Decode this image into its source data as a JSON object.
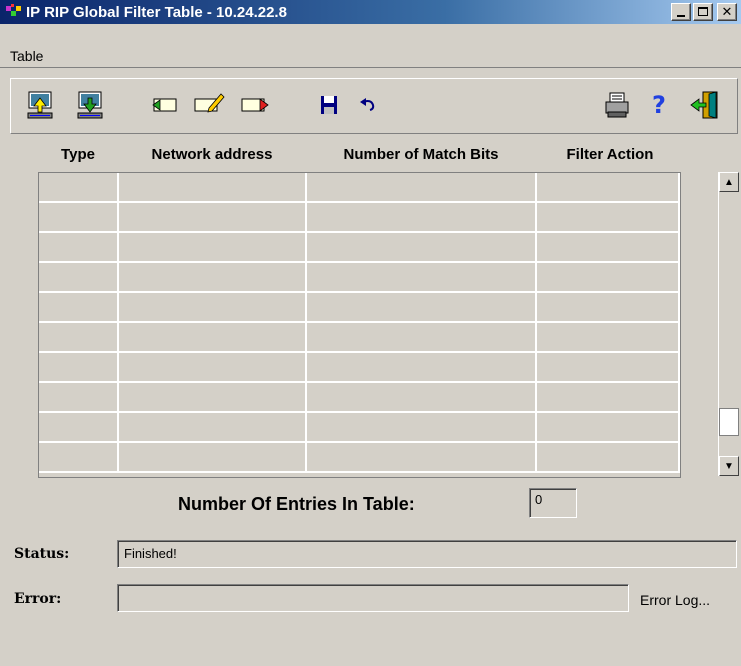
{
  "window": {
    "title": "IP RIP Global Filter Table - 10.24.22.8",
    "minimize_icon": "minimize-icon",
    "maximize_icon": "maximize-icon",
    "close_icon": "close-icon"
  },
  "menu": {
    "items": [
      "Table"
    ]
  },
  "toolbar": {
    "buttons": [
      {
        "icon": "upload-icon"
      },
      {
        "icon": "download-icon"
      },
      {
        "icon": "add-row-icon"
      },
      {
        "icon": "edit-row-icon"
      },
      {
        "icon": "delete-row-icon"
      },
      {
        "icon": "save-icon"
      },
      {
        "icon": "undo-icon"
      },
      {
        "icon": "print-icon"
      },
      {
        "icon": "help-icon",
        "glyph": "?"
      },
      {
        "icon": "exit-icon"
      }
    ]
  },
  "table": {
    "columns": [
      "Type",
      "Network address",
      "Number of Match Bits",
      "Filter Action"
    ],
    "row_count_visible": 10,
    "rows": []
  },
  "entries": {
    "label": "Number Of Entries In Table:",
    "value": "0"
  },
  "status": {
    "label": "Status:",
    "value": "Finished!"
  },
  "error": {
    "label": "Error:",
    "value": "",
    "log_label": "Error Log..."
  },
  "colors": {
    "window_bg": "#d4d0c8",
    "title_start": "#0a246a",
    "title_end": "#a6caf0"
  }
}
